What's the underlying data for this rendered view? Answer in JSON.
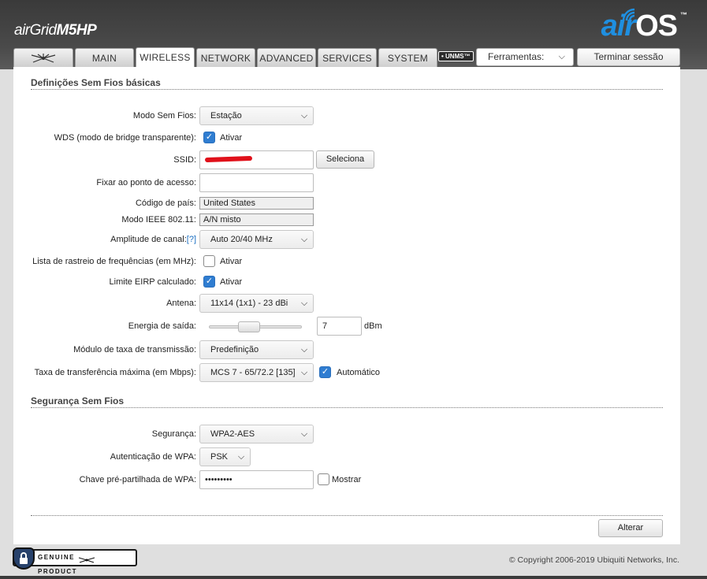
{
  "header": {
    "product_prefix": "air",
    "product_grid": "Grid",
    "product_model": "M5HP",
    "os_air": "air",
    "os_label": "OS",
    "tm": "™"
  },
  "tabs": [
    {
      "label": ""
    },
    {
      "label": "MAIN"
    },
    {
      "label": "WIRELESS"
    },
    {
      "label": "NETWORK"
    },
    {
      "label": "ADVANCED"
    },
    {
      "label": "SERVICES"
    },
    {
      "label": "SYSTEM"
    }
  ],
  "active_tab": "WIRELESS",
  "unms_badge": "• UNMS™",
  "tools": {
    "label": "Ferramentas:"
  },
  "logout_label": "Terminar sessão",
  "basic": {
    "title": "Definições Sem Fios básicas",
    "wireless_mode": {
      "label": "Modo Sem Fios:",
      "value": "Estação"
    },
    "wds": {
      "label": "WDS (modo de bridge transparente):",
      "check_label": "Ativar",
      "checked": true
    },
    "ssid": {
      "label": "SSID:",
      "value": "",
      "select_button": "Seleciona"
    },
    "lock_ap": {
      "label": "Fixar ao ponto de acesso:",
      "value": ""
    },
    "country": {
      "label": "Código de país:",
      "value": "United States"
    },
    "ieee": {
      "label": "Modo IEEE 802.11:",
      "value": "A/N misto"
    },
    "channel_width": {
      "label": "Amplitude de canal:",
      "help": "[?]",
      "value": "Auto 20/40 MHz"
    },
    "freq_scan": {
      "label": "Lista de rastreio de frequências (em MHz):",
      "check_label": "Ativar",
      "checked": false
    },
    "eirp": {
      "label": "Limite EIRP calculado:",
      "check_label": "Ativar",
      "checked": true
    },
    "antenna": {
      "label": "Antena:",
      "value": "11x14 (1x1) - 23 dBi"
    },
    "output_power": {
      "label": "Energia de saída:",
      "value": "7",
      "unit": "dBm",
      "slider_fraction": 0.4
    },
    "data_rate_module": {
      "label": "Módulo de taxa de transmissão:",
      "value": "Predefinição"
    },
    "max_rate": {
      "label": "Taxa de transferência máxima (em Mbps):",
      "value": "MCS 7 - 65/72.2 [135]",
      "check_label": "Automático",
      "checked": true
    }
  },
  "security": {
    "title": "Segurança Sem Fios",
    "security": {
      "label": "Segurança:",
      "value": "WPA2-AES"
    },
    "wpa_auth": {
      "label": "Autenticação de WPA:",
      "value": "PSK"
    },
    "psk": {
      "label": "Chave pré-partilhada de WPA:",
      "value": "•••••••••",
      "show_label": "Mostrar",
      "show_checked": false
    }
  },
  "apply_label": "Alterar",
  "footer": {
    "copyright": "© Copyright 2006-2019 Ubiquiti Networks, Inc.",
    "genuine_left": "GENUINE",
    "genuine_right": "PRODUCT"
  }
}
